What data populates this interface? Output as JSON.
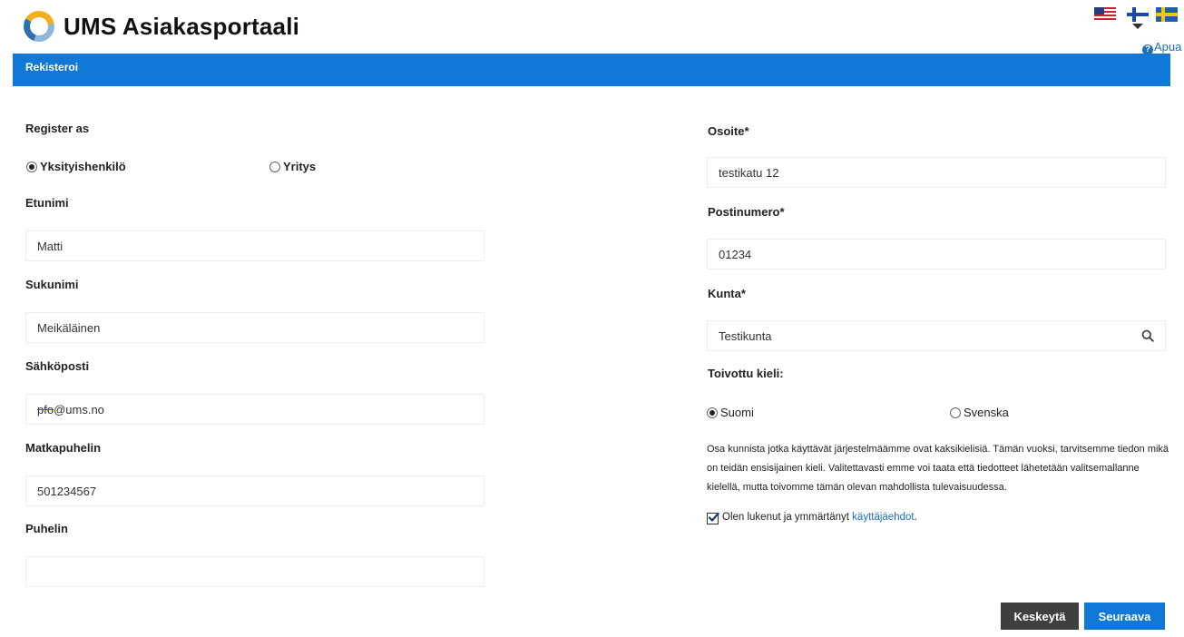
{
  "header": {
    "title": "UMS Asiakasportaali",
    "help_label": "Apua"
  },
  "bar": {
    "title": "Rekisteroi"
  },
  "form": {
    "register_as_label": "Register as",
    "radio_private": "Yksityishenkilö",
    "radio_company": "Yritys",
    "first_name_label": "Etunimi",
    "first_name_value": "Matti",
    "last_name_label": "Sukunimi",
    "last_name_value": "Meikäläinen",
    "email_label": "Sähköposti",
    "email_prefix": "pfo",
    "email_rest": "@ums.no",
    "mobile_label": "Matkapuhelin",
    "mobile_value": "501234567",
    "phone_label": "Puhelin",
    "phone_value": "",
    "address_label": "Osoite*",
    "address_value": "testikatu 12",
    "postal_label": "Postinumero*",
    "postal_value": "01234",
    "municipality_label": "Kunta*",
    "municipality_value": "Testikunta",
    "language_label": "Toivottu kieli:",
    "language_finnish": "Suomi",
    "language_swedish": "Svenska",
    "info_text": "Osa kunnista jotka käyttävät järjestelmäämme ovat kaksikielisiä. Tämän vuoksi, tarvitsemme tiedon mikä on teidän ensisijainen kieli. Valitettavasti emme voi taata että tiedotteet lähetetään valitsemallanne kielellä, mutta toivomme tämän olevan mahdollista tulevaisuudessa.",
    "terms_text": "Olen lukenut ja ymmärtänyt ",
    "terms_link": "käyttäjäehdot",
    "terms_period": "."
  },
  "buttons": {
    "cancel": "Keskeytä",
    "next": "Seuraava"
  },
  "colors": {
    "brand_blue": "#1078d6",
    "cancel_gray": "#3f3f3f",
    "link_blue": "#1a6fb8"
  },
  "icons": {
    "logo": "ums-logo-icon",
    "search": "search-icon",
    "help": "help-icon",
    "flags": [
      "flag-us-icon",
      "flag-fi-icon",
      "flag-se-icon"
    ]
  }
}
